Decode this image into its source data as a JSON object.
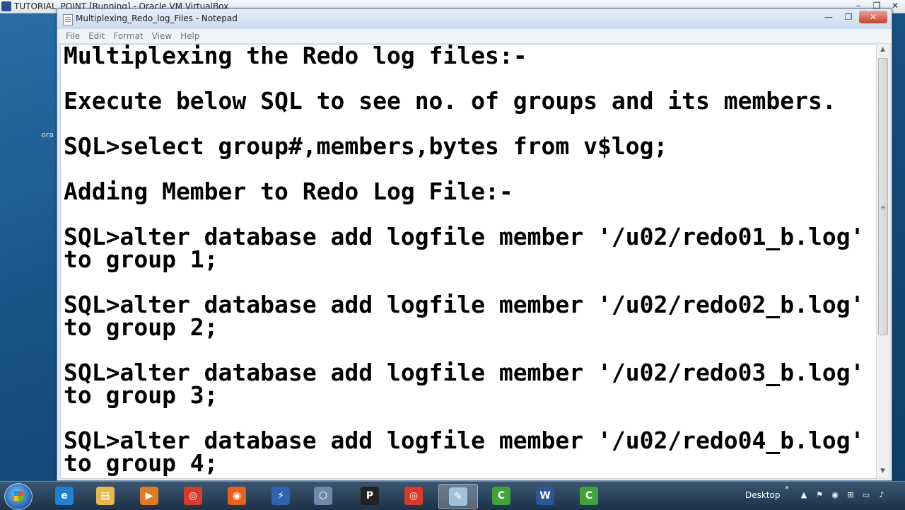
{
  "vbox": {
    "title": "TUTORIAL_POINT [Running] - Oracle VM VirtualBox",
    "controls": [
      "–",
      "❐",
      "✕"
    ]
  },
  "desktop": {
    "label": "ora"
  },
  "notepad": {
    "title": "Multiplexing_Redo_log_Files - Notepad",
    "controls": {
      "minimize": "—",
      "maximize": "❐",
      "close": "✕"
    },
    "menu": [
      "File",
      "Edit",
      "Format",
      "View",
      "Help"
    ],
    "content": "Multiplexing the Redo log files:-\n\nExecute below SQL to see no. of groups and its members.\n\nSQL>select group#,members,bytes from v$log;\n\nAdding Member to Redo Log File:-\n\nSQL>alter database add logfile member '/u02/redo01_b.log'\nto group 1;\n\nSQL>alter database add logfile member '/u02/redo02_b.log'\nto group 2;\n\nSQL>alter database add logfile member '/u02/redo03_b.log'\nto group 3;\n\nSQL>alter database add logfile member '/u02/redo04_b.log'\nto group 4;",
    "scroll": {
      "up": "▲",
      "down": "▼"
    }
  },
  "taskbar": {
    "items": [
      {
        "name": "internet-explorer-icon",
        "glyph": "e",
        "color": "#1f7fd1"
      },
      {
        "name": "file-explorer-icon",
        "glyph": "▤",
        "color": "#e8b84a"
      },
      {
        "name": "media-player-icon",
        "glyph": "▶",
        "color": "#e07b1f"
      },
      {
        "name": "chrome-icon",
        "glyph": "◎",
        "color": "#d93b2b"
      },
      {
        "name": "firefox-icon",
        "glyph": "◉",
        "color": "#e8621f"
      },
      {
        "name": "network-tool-icon",
        "glyph": "⚡",
        "color": "#2f62b0"
      },
      {
        "name": "virtualbox-icon",
        "glyph": "⬡",
        "color": "#6e8aa8"
      },
      {
        "name": "putty-icon",
        "glyph": "P",
        "color": "#222222"
      },
      {
        "name": "chrome-icon-2",
        "glyph": "◎",
        "color": "#d93b2b"
      },
      {
        "name": "notepad-icon",
        "glyph": "✎",
        "color": "#9fc3dc"
      },
      {
        "name": "camtasia-icon",
        "glyph": "C",
        "color": "#3fa33a"
      },
      {
        "name": "word-icon",
        "glyph": "W",
        "color": "#2b5797"
      },
      {
        "name": "camtasia-icon-2",
        "glyph": "C",
        "color": "#3fa33a"
      }
    ],
    "desktop_label": "Desktop",
    "tray_chevron": "»",
    "tray_icons": [
      "▲",
      "⚑",
      "◉",
      "⊞",
      "▭",
      "♪"
    ]
  }
}
